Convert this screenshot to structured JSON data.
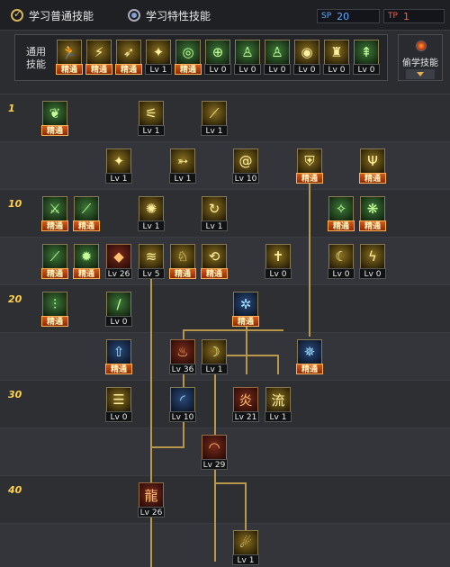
{
  "tabs": [
    {
      "label": "学习普通技能",
      "active": true
    },
    {
      "label": "学习特性技能",
      "active": false
    }
  ],
  "points": {
    "blue": {
      "icon_label": "SP",
      "value": "20"
    },
    "red": {
      "icon_label": "TP",
      "value": "1"
    }
  },
  "common": {
    "label": "通用技能",
    "skills": [
      {
        "icon": "runner-icon",
        "badge": "精通",
        "badge_type": "m",
        "color": "yellow"
      },
      {
        "icon": "kick-icon",
        "badge": "精通",
        "badge_type": "m",
        "color": "yellow"
      },
      {
        "icon": "dash-icon",
        "badge": "精通",
        "badge_type": "m",
        "color": "yellow"
      },
      {
        "icon": "wings-icon",
        "badge": "Lv 1",
        "badge_type": "l",
        "color": "yellow"
      },
      {
        "icon": "target-icon",
        "badge": "精通",
        "badge_type": "m",
        "color": "green"
      },
      {
        "icon": "crosshair-icon",
        "badge": "Lv 0",
        "badge_type": "l",
        "color": "green"
      },
      {
        "icon": "figure-icon",
        "badge": "Lv 0",
        "badge_type": "l",
        "color": "green"
      },
      {
        "icon": "figure-icon",
        "badge": "Lv 0",
        "badge_type": "l",
        "color": "green"
      },
      {
        "icon": "orb-icon",
        "badge": "Lv 0",
        "badge_type": "l",
        "color": "yellow"
      },
      {
        "icon": "muscle-icon",
        "badge": "Lv 0",
        "badge_type": "l",
        "color": "yellow"
      },
      {
        "icon": "climb-icon",
        "badge": "Lv 0",
        "badge_type": "l",
        "color": "green"
      }
    ]
  },
  "steal_button": {
    "label": "偷学技能"
  },
  "levels": [
    "1",
    "10",
    "20",
    "30",
    "40"
  ],
  "tree": [
    {
      "col": 0,
      "row": 0,
      "icon": "leaf-icon",
      "badge": "精通",
      "badge_type": "m",
      "color": "green"
    },
    {
      "col": 3,
      "row": 0,
      "icon": "claw-icon",
      "badge": "Lv 1",
      "badge_type": "l",
      "color": "yellow"
    },
    {
      "col": 5,
      "row": 0,
      "icon": "slash-icon",
      "badge": "Lv 1",
      "badge_type": "l",
      "color": "yellow"
    },
    {
      "col": 2,
      "row": 1,
      "icon": "wings-icon",
      "badge": "Lv 1",
      "badge_type": "l",
      "color": "yellow"
    },
    {
      "col": 4,
      "row": 1,
      "icon": "bow-icon",
      "badge": "Lv 1",
      "badge_type": "l",
      "color": "yellow"
    },
    {
      "col": 6,
      "row": 1,
      "icon": "spiral-icon",
      "badge": "Lv 10",
      "badge_type": "l",
      "color": "yellow"
    },
    {
      "col": 8,
      "row": 1,
      "icon": "shield-icon",
      "badge": "精通",
      "badge_type": "m",
      "color": "yellow"
    },
    {
      "col": 10,
      "row": 1,
      "icon": "trident-icon",
      "badge": "精通",
      "badge_type": "m",
      "color": "yellow"
    },
    {
      "col": 0,
      "row": 2,
      "icon": "sword-icon",
      "badge": "精通",
      "badge_type": "m",
      "color": "green"
    },
    {
      "col": 1,
      "row": 2,
      "icon": "blade-icon",
      "badge": "精通",
      "badge_type": "m",
      "color": "green"
    },
    {
      "col": 3,
      "row": 2,
      "icon": "burst-icon",
      "badge": "Lv 1",
      "badge_type": "l",
      "color": "yellow"
    },
    {
      "col": 5,
      "row": 2,
      "icon": "loop-icon",
      "badge": "Lv 1",
      "badge_type": "l",
      "color": "yellow"
    },
    {
      "col": 9,
      "row": 2,
      "icon": "greatsword-icon",
      "badge": "精通",
      "badge_type": "m",
      "color": "green"
    },
    {
      "col": 10,
      "row": 2,
      "icon": "swirl-icon",
      "badge": "精通",
      "badge_type": "m",
      "color": "green"
    },
    {
      "col": 0,
      "row": 3,
      "icon": "blade-icon",
      "badge": "精通",
      "badge_type": "m",
      "color": "green"
    },
    {
      "col": 1,
      "row": 3,
      "icon": "spark-icon",
      "badge": "精通",
      "badge_type": "m",
      "color": "green"
    },
    {
      "col": 2,
      "row": 3,
      "icon": "gem-icon",
      "badge": "Lv 26",
      "badge_type": "l",
      "color": "red"
    },
    {
      "col": 3,
      "row": 3,
      "icon": "whirl-icon",
      "badge": "Lv 5",
      "badge_type": "l",
      "color": "yellow"
    },
    {
      "col": 4,
      "row": 3,
      "icon": "jump-icon",
      "badge": "精通",
      "badge_type": "m",
      "color": "yellow"
    },
    {
      "col": 5,
      "row": 3,
      "icon": "hook-icon",
      "badge": "精通",
      "badge_type": "m",
      "color": "yellow"
    },
    {
      "col": 7,
      "row": 3,
      "icon": "cross-icon",
      "badge": "Lv 0",
      "badge_type": "l",
      "color": "yellow"
    },
    {
      "col": 9,
      "row": 3,
      "icon": "crescent-icon",
      "badge": "Lv 0",
      "badge_type": "l",
      "color": "yellow"
    },
    {
      "col": 10,
      "row": 3,
      "icon": "lightning-icon",
      "badge": "Lv 0",
      "badge_type": "l",
      "color": "yellow"
    },
    {
      "col": 0,
      "row": 4,
      "icon": "bamboo-icon",
      "badge": "精通",
      "badge_type": "m",
      "color": "green"
    },
    {
      "col": 2,
      "row": 4,
      "icon": "pole-icon",
      "badge": "Lv 0",
      "badge_type": "l",
      "color": "green"
    },
    {
      "col": 6,
      "row": 4,
      "icon": "rune-icon",
      "badge": "精通",
      "badge_type": "m",
      "color": "blue"
    },
    {
      "col": 2,
      "row": 5,
      "icon": "arrow-up-icon",
      "badge": "精通",
      "badge_type": "m",
      "color": "blue"
    },
    {
      "col": 4,
      "row": 5,
      "icon": "flame-icon",
      "badge": "Lv 36",
      "badge_type": "l",
      "color": "red"
    },
    {
      "col": 5,
      "row": 5,
      "icon": "moon-icon",
      "badge": "Lv 1",
      "badge_type": "l",
      "color": "yellow"
    },
    {
      "col": 8,
      "row": 5,
      "icon": "star-icon",
      "badge": "精通",
      "badge_type": "m",
      "color": "blue"
    },
    {
      "col": 2,
      "row": 6,
      "icon": "bars-icon",
      "badge": "Lv 0",
      "badge_type": "l",
      "color": "yellow"
    },
    {
      "col": 4,
      "row": 6,
      "icon": "arc-icon",
      "badge": "Lv 10",
      "badge_type": "l",
      "color": "blue"
    },
    {
      "col": 6,
      "row": 6,
      "icon": "fire-text-icon",
      "badge": "Lv 21",
      "badge_type": "l",
      "color": "red"
    },
    {
      "col": 7,
      "row": 6,
      "icon": "flow-icon",
      "badge": "Lv 1",
      "badge_type": "l",
      "color": "yellow"
    },
    {
      "col": 5,
      "row": 7,
      "icon": "red-arc-icon",
      "badge": "Lv 29",
      "badge_type": "l",
      "color": "red"
    },
    {
      "col": 3,
      "row": 8,
      "icon": "dragon-icon",
      "badge": "Lv 26",
      "badge_type": "l",
      "color": "red"
    },
    {
      "col": 6,
      "row": 9,
      "icon": "comet-icon",
      "badge": "Lv 1",
      "badge_type": "l",
      "color": "yellow"
    }
  ]
}
